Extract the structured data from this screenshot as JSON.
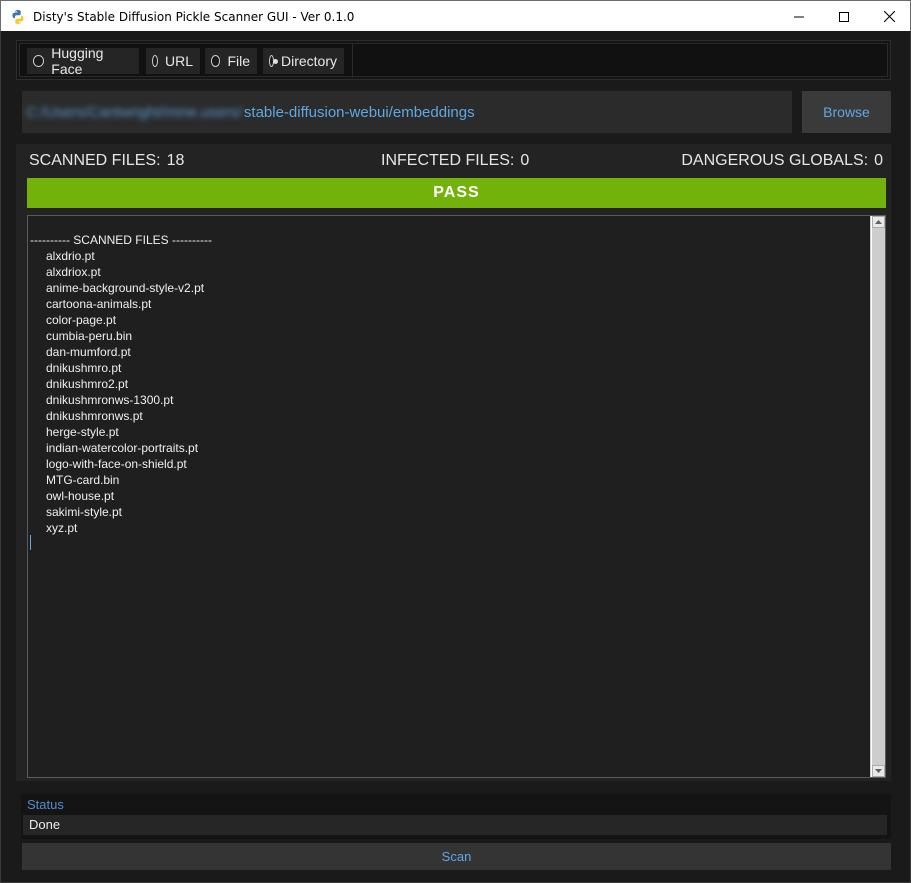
{
  "window": {
    "title": "Disty's Stable Diffusion Pickle Scanner GUI - Ver 0.1.0",
    "app_icon": "python-icon",
    "controls": [
      "minimize-icon",
      "maximize-icon",
      "close-icon"
    ]
  },
  "source": {
    "options": [
      {
        "label": "Hugging Face",
        "selected": false
      },
      {
        "label": "URL",
        "selected": false
      },
      {
        "label": "File",
        "selected": false
      },
      {
        "label": "Directory",
        "selected": true
      }
    ]
  },
  "path": {
    "blurred_prefix": "C:/Users/Cantwright/mine.users/",
    "visible": "stable-diffusion-webui/embeddings"
  },
  "browse_label": "Browse",
  "stats": {
    "scanned_label": "SCANNED FILES:",
    "scanned_value": "18",
    "infected_label": "INFECTED FILES:",
    "infected_value": "0",
    "dangerous_label": "DANGEROUS GLOBALS:",
    "dangerous_value": "0"
  },
  "result": {
    "label": "PASS",
    "color": "#73b20a"
  },
  "log": {
    "header": "---------- SCANNED FILES ----------",
    "files": [
      "alxdrio.pt",
      "alxdriox.pt",
      "anime-background-style-v2.pt",
      "cartoona-animals.pt",
      "color-page.pt",
      "cumbia-peru.bin",
      "dan-mumford.pt",
      "dnikushmro.pt",
      "dnikushmro2.pt",
      "dnikushmronws-1300.pt",
      "dnikushmronws.pt",
      "herge-style.pt",
      "indian-watercolor-portraits.pt",
      "logo-with-face-on-shield.pt",
      "MTG-card.bin",
      "owl-house.pt",
      "sakimi-style.pt",
      "xyz.pt"
    ]
  },
  "status": {
    "label": "Status",
    "value": "Done"
  },
  "scan_label": "Scan",
  "colors": {
    "accent": "#5ea8e6",
    "background": "#1a1a1a",
    "pass": "#73b20a"
  }
}
